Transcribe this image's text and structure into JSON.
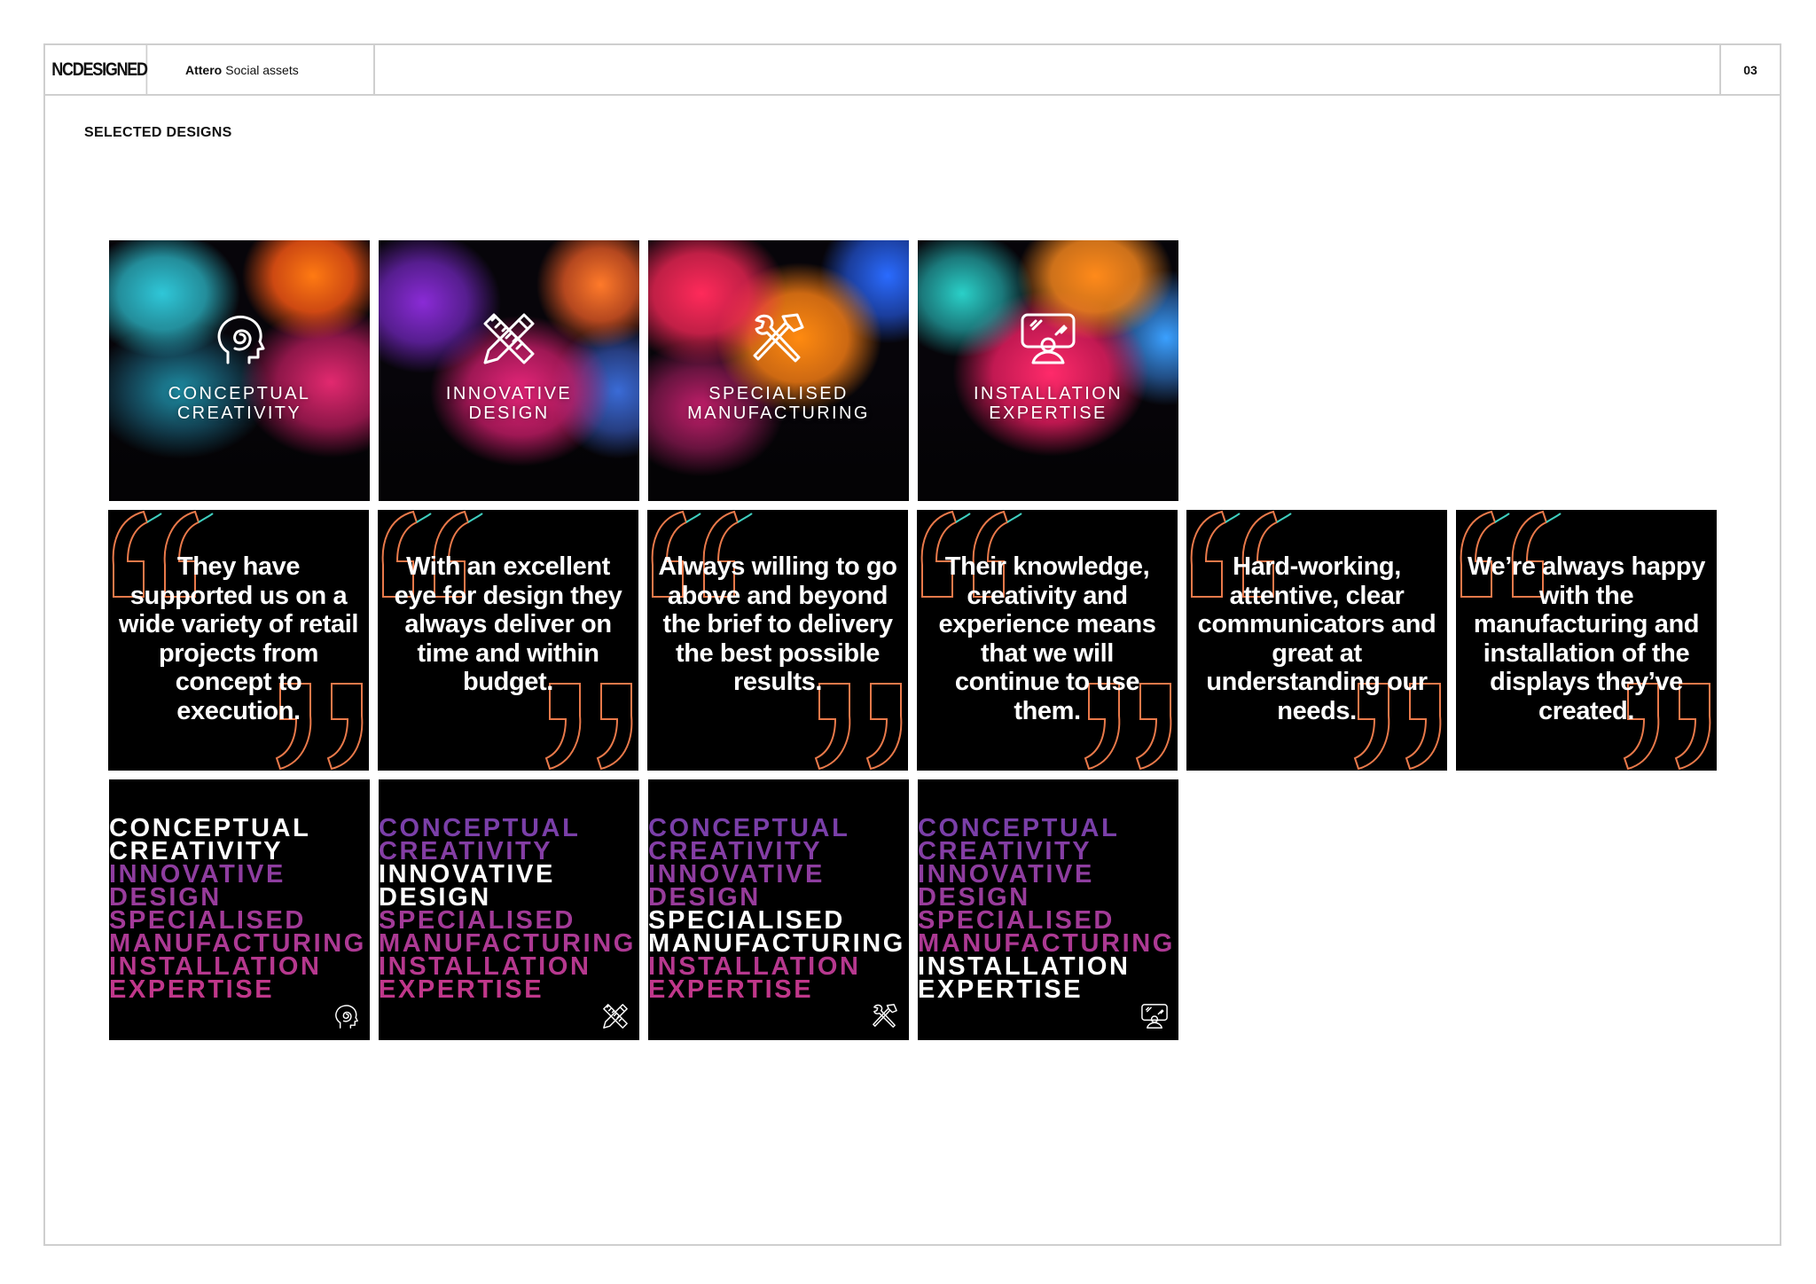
{
  "header": {
    "logo_text": "NCDESIGNED",
    "project_bold": "Attero",
    "project_rest": "Social assets",
    "page_number": "03"
  },
  "section_title": "SELECTED DESIGNS",
  "smoke_tiles": [
    {
      "line1": "CONCEPTUAL",
      "line2": "CREATIVITY",
      "icon": "head-spiral-icon"
    },
    {
      "line1": "INNOVATIVE",
      "line2": "DESIGN",
      "icon": "pencil-ruler-icon"
    },
    {
      "line1": "SPECIALISED",
      "line2": "MANUFACTURING",
      "icon": "hammer-wrench-icon"
    },
    {
      "line1": "INSTALLATION",
      "line2": "EXPERTISE",
      "icon": "display-person-icon"
    }
  ],
  "quotes": [
    "They have supported us on a wide variety of retail projects from concept to execution.",
    "With an excellent eye for design they always deliver on time and within budget.",
    "Always willing to go above and beyond the brief to delivery the best possible results.",
    "Their knowledge, creativity and experience means that we will continue to use them.",
    "Hard-working, attentive, clear communicators and great at understanding our needs.",
    "We’re always happy with the manufacturing and installation of the displays they’ve created."
  ],
  "type_lines": [
    "CONCEPTUAL",
    "CREATIVITY",
    "INNOVATIVE",
    "DESIGN",
    "SPECIALISED",
    "MANUFACTURING",
    "INSTALLATION",
    "EXPERTISE"
  ],
  "type_tiles": [
    {
      "highlight": 0,
      "icon": "head-spiral-icon"
    },
    {
      "highlight": 1,
      "icon": "pencil-ruler-icon"
    },
    {
      "highlight": 2,
      "icon": "hammer-wrench-icon"
    },
    {
      "highlight": 3,
      "icon": "display-person-icon"
    }
  ],
  "colors": {
    "gradient_top": "#7a3fa8",
    "gradient_bottom": "#c0378a",
    "quote_mark_left": "#e9794a",
    "quote_mark_mid": "#3fd0c0"
  }
}
